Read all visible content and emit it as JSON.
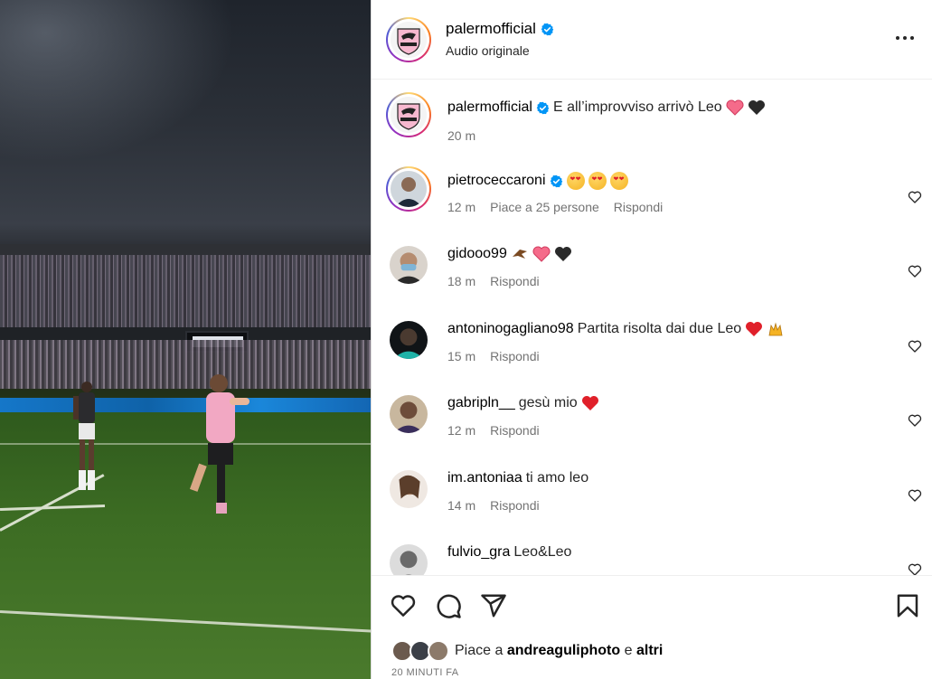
{
  "header": {
    "username": "palermofficial",
    "audio": "Audio originale",
    "more_icon": "more-horizontal-icon"
  },
  "caption": {
    "username": "palermofficial",
    "text": "E all’improvviso arrivò Leo",
    "time": "20 m"
  },
  "comments": [
    {
      "username": "pietroceccaroni",
      "text": "",
      "time": "12 m",
      "likes": "Piace a 25 persone",
      "reply": "Rispondi",
      "verified": true
    },
    {
      "username": "gidooo99",
      "text": "",
      "time": "18 m",
      "likes": "",
      "reply": "Rispondi",
      "verified": false
    },
    {
      "username": "antoninogagliano98",
      "text": "Partita risolta dai due Leo",
      "time": "15 m",
      "likes": "",
      "reply": "Rispondi",
      "verified": false
    },
    {
      "username": "gabripln__",
      "text": "gesù mio",
      "time": "12 m",
      "likes": "",
      "reply": "Rispondi",
      "verified": false
    },
    {
      "username": "im.antoniaa",
      "text": "ti amo leo",
      "time": "14 m",
      "likes": "",
      "reply": "Rispondi",
      "verified": false
    },
    {
      "username": "fulvio_gra",
      "text": "Leo&Leo",
      "time": "",
      "likes": "",
      "reply": "",
      "verified": false
    }
  ],
  "actions": {
    "like_icon": "heart-icon",
    "comment_icon": "comment-icon",
    "share_icon": "send-icon",
    "save_icon": "bookmark-icon"
  },
  "likes": {
    "prefix": "Piace a",
    "user": "andreaguliphoto",
    "conjunction": "e",
    "others": "altri"
  },
  "timestamp": "20 MINUTI FA",
  "colors": {
    "verified": "#0095f6",
    "heart_red": "#e0202a",
    "meta_gray": "#737373"
  }
}
